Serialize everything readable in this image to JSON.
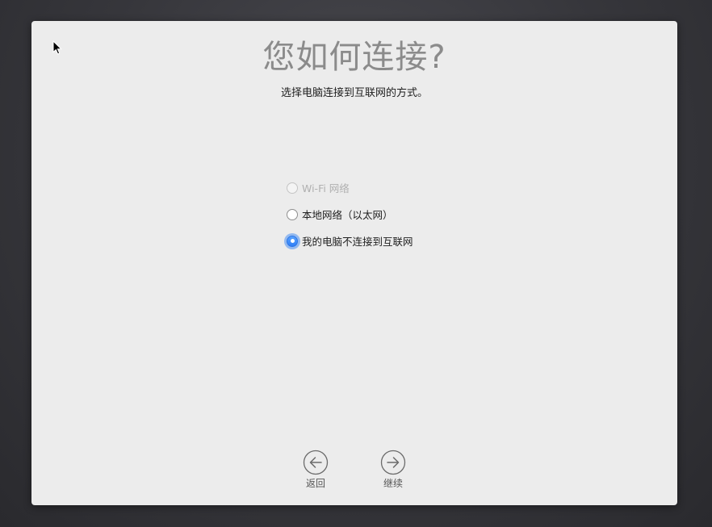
{
  "setup": {
    "title": "您如何连接?",
    "subtitle": "选择电脑连接到互联网的方式。"
  },
  "options": [
    {
      "label": "Wi-Fi 网络",
      "state": "disabled"
    },
    {
      "label": "本地网络（以太网）",
      "state": "unselected"
    },
    {
      "label": "我的电脑不连接到互联网",
      "state": "selected"
    }
  ],
  "navigation": {
    "back_label": "返回",
    "back_icon": "arrow-left-circle-icon",
    "continue_label": "继续",
    "continue_icon": "arrow-right-circle-icon"
  },
  "colors": {
    "accent": "#2f7ef6",
    "window_background": "#ececec",
    "title_color": "#8b8b8b"
  }
}
